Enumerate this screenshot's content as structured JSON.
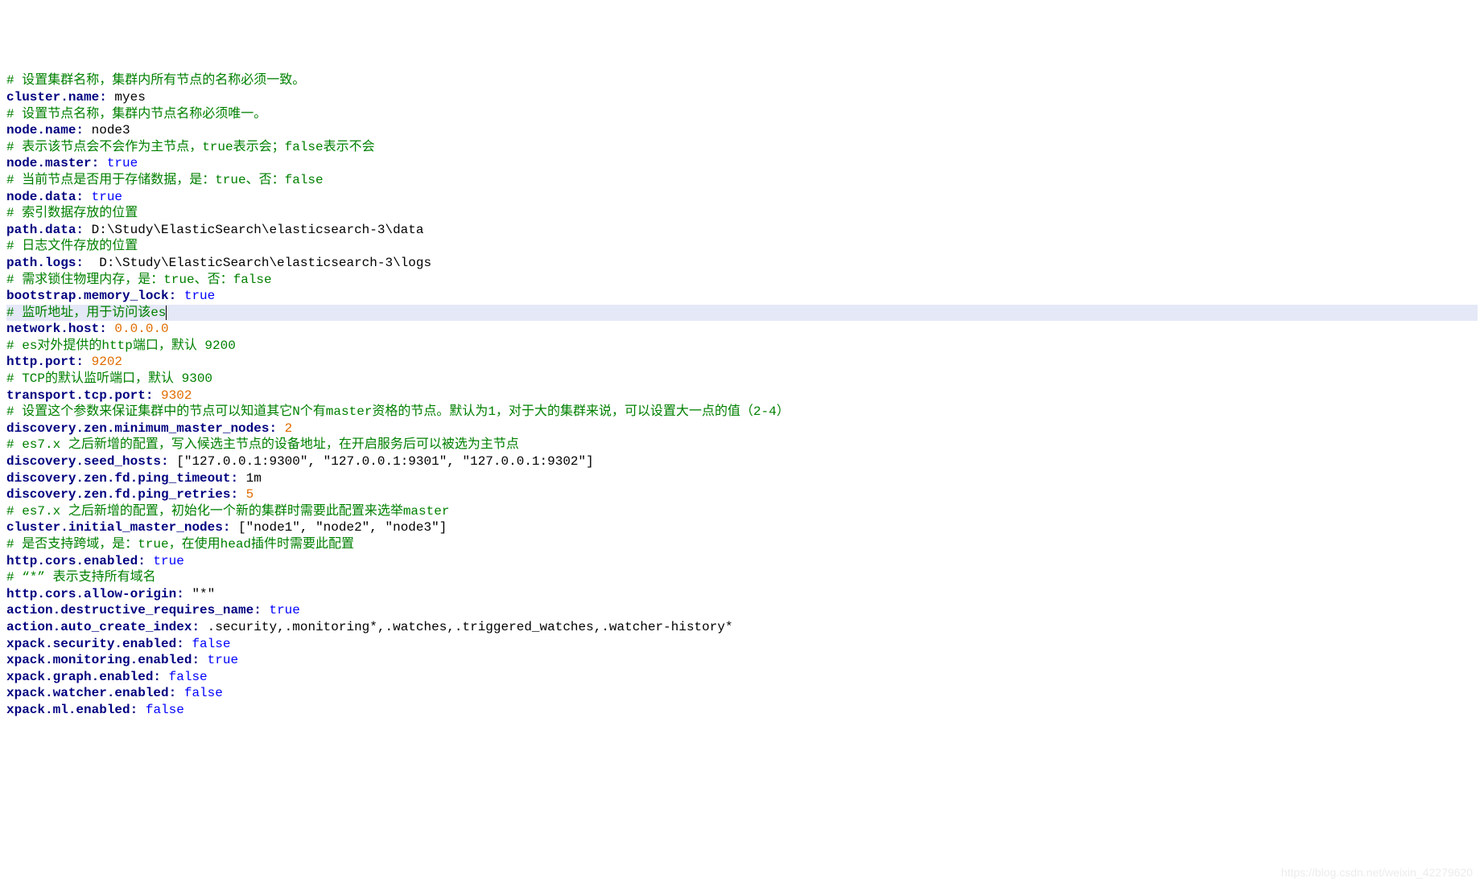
{
  "lines": [
    {
      "type": "comment",
      "text": "# 设置集群名称，集群内所有节点的名称必须一致。"
    },
    {
      "type": "kv",
      "key": "cluster.name:",
      "value": " myes",
      "valClass": "s"
    },
    {
      "type": "comment",
      "text": "# 设置节点名称，集群内节点名称必须唯一。"
    },
    {
      "type": "kv",
      "key": "node.name:",
      "value": " node3",
      "valClass": "s"
    },
    {
      "type": "comment",
      "text": "# 表示该节点会不会作为主节点，true表示会；false表示不会"
    },
    {
      "type": "kv",
      "key": "node.master:",
      "value": " true",
      "valClass": "b"
    },
    {
      "type": "comment",
      "text": "# 当前节点是否用于存储数据，是：true、否：false"
    },
    {
      "type": "kv",
      "key": "node.data:",
      "value": " true",
      "valClass": "b"
    },
    {
      "type": "comment",
      "text": "# 索引数据存放的位置"
    },
    {
      "type": "kv",
      "key": "path.data:",
      "value": " D:\\Study\\ElasticSearch\\elasticsearch-3\\data",
      "valClass": "s"
    },
    {
      "type": "comment",
      "text": "# 日志文件存放的位置"
    },
    {
      "type": "kv",
      "key": "path.logs:",
      "value": "  D:\\Study\\ElasticSearch\\elasticsearch-3\\logs",
      "valClass": "s"
    },
    {
      "type": "comment",
      "text": "# 需求锁住物理内存，是：true、否：false"
    },
    {
      "type": "kv",
      "key": "bootstrap.memory_lock:",
      "value": " true",
      "valClass": "b"
    },
    {
      "type": "comment",
      "text": "# 监听地址，用于访问该es",
      "highlight": true,
      "cursor": true
    },
    {
      "type": "kv",
      "key": "network.host:",
      "value": " 0.0.0.0",
      "valClass": "n"
    },
    {
      "type": "comment",
      "text": "# es对外提供的http端口，默认 9200"
    },
    {
      "type": "kv",
      "key": "http.port:",
      "value": " 9202",
      "valClass": "n"
    },
    {
      "type": "comment",
      "text": "# TCP的默认监听端口，默认 9300"
    },
    {
      "type": "kv",
      "key": "transport.tcp.port:",
      "value": " 9302",
      "valClass": "n"
    },
    {
      "type": "comment",
      "text": "# 设置这个参数来保证集群中的节点可以知道其它N个有master资格的节点。默认为1，对于大的集群来说，可以设置大一点的值（2-4）"
    },
    {
      "type": "kv",
      "key": "discovery.zen.minimum_master_nodes:",
      "value": " 2",
      "valClass": "n"
    },
    {
      "type": "comment",
      "text": "# es7.x 之后新增的配置，写入候选主节点的设备地址，在开启服务后可以被选为主节点"
    },
    {
      "type": "kv",
      "key": "discovery.seed_hosts:",
      "value": " [\"127.0.0.1:9300\", \"127.0.0.1:9301\", \"127.0.0.1:9302\"]",
      "valClass": "s"
    },
    {
      "type": "kv",
      "key": "discovery.zen.fd.ping_timeout:",
      "value": " 1m",
      "valClass": "s"
    },
    {
      "type": "kv",
      "key": "discovery.zen.fd.ping_retries:",
      "value": " 5",
      "valClass": "n"
    },
    {
      "type": "comment",
      "text": "# es7.x 之后新增的配置，初始化一个新的集群时需要此配置来选举master"
    },
    {
      "type": "kv",
      "key": "cluster.initial_master_nodes:",
      "value": " [\"node1\", \"node2\", \"node3\"]",
      "valClass": "s"
    },
    {
      "type": "comment",
      "text": "# 是否支持跨域，是：true，在使用head插件时需要此配置"
    },
    {
      "type": "kv",
      "key": "http.cors.enabled:",
      "value": " true",
      "valClass": "b"
    },
    {
      "type": "comment",
      "text": "# “*” 表示支持所有域名"
    },
    {
      "type": "kv",
      "key": "http.cors.allow-origin:",
      "value": " \"*\"",
      "valClass": "s"
    },
    {
      "type": "kv",
      "key": "action.destructive_requires_name:",
      "value": " true",
      "valClass": "b"
    },
    {
      "type": "kv",
      "key": "action.auto_create_index:",
      "value": " .security,.monitoring*,.watches,.triggered_watches,.watcher-history*",
      "valClass": "s"
    },
    {
      "type": "kv",
      "key": "xpack.security.enabled:",
      "value": " false",
      "valClass": "b"
    },
    {
      "type": "kv",
      "key": "xpack.monitoring.enabled:",
      "value": " true",
      "valClass": "b"
    },
    {
      "type": "kv",
      "key": "xpack.graph.enabled:",
      "value": " false",
      "valClass": "b"
    },
    {
      "type": "kv",
      "key": "xpack.watcher.enabled:",
      "value": " false",
      "valClass": "b"
    },
    {
      "type": "kv",
      "key": "xpack.ml.enabled:",
      "value": " false",
      "valClass": "b"
    }
  ],
  "watermark": "https://blog.csdn.net/weixin_42279620"
}
